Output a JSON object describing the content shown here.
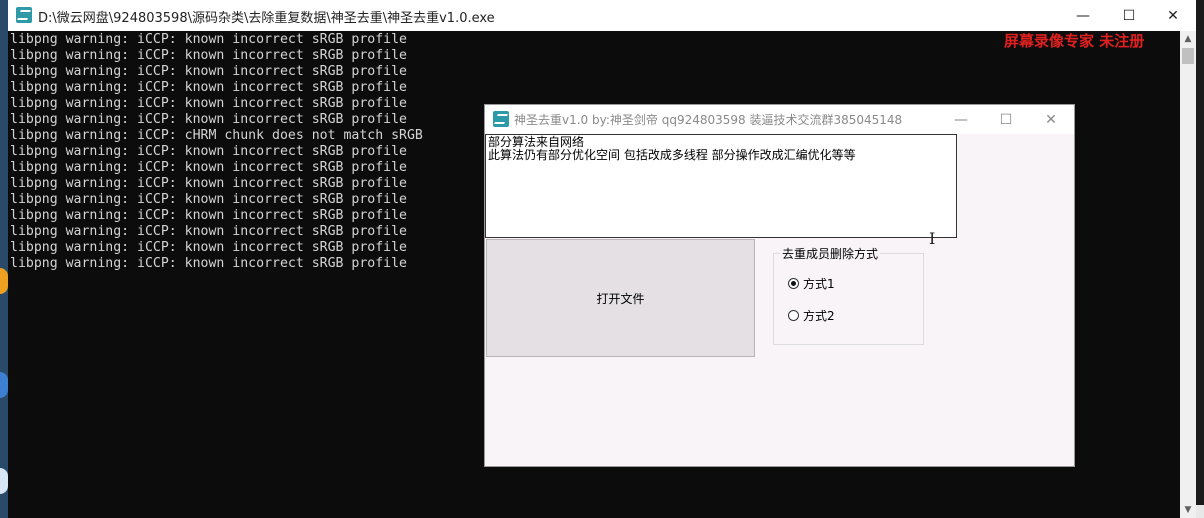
{
  "console_window": {
    "title": "D:\\微云网盘\\924803598\\源码杂类\\去除重复数据\\神圣去重\\神圣去重v1.0.exe",
    "controls": {
      "minimize": "—",
      "maximize": "☐",
      "close": "✕"
    },
    "lines": [
      "libpng warning: iCCP: known incorrect sRGB profile",
      "libpng warning: iCCP: known incorrect sRGB profile",
      "libpng warning: iCCP: known incorrect sRGB profile",
      "libpng warning: iCCP: known incorrect sRGB profile",
      "libpng warning: iCCP: known incorrect sRGB profile",
      "libpng warning: iCCP: known incorrect sRGB profile",
      "libpng warning: iCCP: cHRM chunk does not match sRGB",
      "libpng warning: iCCP: known incorrect sRGB profile",
      "libpng warning: iCCP: known incorrect sRGB profile",
      "libpng warning: iCCP: known incorrect sRGB profile",
      "libpng warning: iCCP: known incorrect sRGB profile",
      "libpng warning: iCCP: known incorrect sRGB profile",
      "libpng warning: iCCP: known incorrect sRGB profile",
      "libpng warning: iCCP: known incorrect sRGB profile",
      "libpng warning: iCCP: known incorrect sRGB profile"
    ],
    "watermark": "屏幕录像专家  未注册"
  },
  "app_window": {
    "title": "神圣去重v1.0 by:神圣剑帝 qq924803598 装逼技术交流群385045148",
    "controls": {
      "minimize": "—",
      "maximize": "☐",
      "close": "✕"
    },
    "memo_lines": [
      "部分算法来自网络",
      "此算法仍有部分优化空间 包括改成多线程 部分操作改成汇编优化等等"
    ],
    "open_button": "打开文件",
    "group_label": "去重成员删除方式",
    "options": [
      "方式1",
      "方式2"
    ],
    "selected_option": "方式1"
  },
  "colors": {
    "console_bg": "#0c0c0c",
    "console_text": "#d4d4d4",
    "watermark": "#e02020",
    "app_bg": "#f8f4f8",
    "icon_teal": "#2e9aa8"
  },
  "icons": [
    "app-icon",
    "minimize-icon",
    "maximize-icon",
    "close-icon",
    "radio-icon",
    "text-cursor-icon"
  ]
}
